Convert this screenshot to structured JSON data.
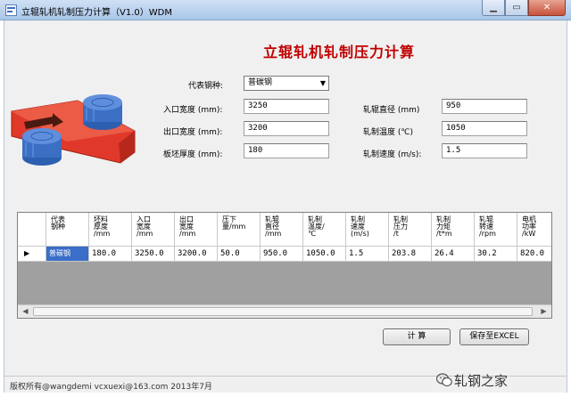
{
  "window": {
    "title": "立辊轧机轧制压力计算（V1.0）WDM"
  },
  "heading": "立辊轧机轧制压力计算",
  "form": {
    "steel_label": "代表钢种:",
    "steel_value": "普碳钢",
    "left": [
      {
        "label": "入口宽度 (mm):",
        "value": "3250"
      },
      {
        "label": "出口宽度 (mm):",
        "value": "3200"
      },
      {
        "label": "板坯厚度 (mm):",
        "value": "180"
      }
    ],
    "right": [
      {
        "label": "轧辊直径 (mm)",
        "value": "950"
      },
      {
        "label": "轧制温度 (℃)",
        "value": "1050"
      },
      {
        "label": "轧制速度 (m/s):",
        "value": "1.5"
      }
    ]
  },
  "grid": {
    "headers": [
      [
        "代表",
        "钢种"
      ],
      [
        "坯料",
        "厚度",
        "/mm"
      ],
      [
        "入口",
        "宽度",
        "/mm"
      ],
      [
        "出口",
        "宽度",
        "/mm"
      ],
      [
        "压下",
        "量/mm"
      ],
      [
        "轧辊",
        "直径",
        "/mm"
      ],
      [
        "轧制",
        "温度/",
        "℃"
      ],
      [
        "轧制",
        "速度",
        "(m/s)"
      ],
      [
        "轧制",
        "压力",
        "/t"
      ],
      [
        "轧制",
        "力矩",
        "/t*m"
      ],
      [
        "轧辊",
        "转速",
        "/rpm"
      ],
      [
        "电机",
        "功率",
        "/kW"
      ]
    ],
    "row_marker": "▶",
    "rows": [
      [
        "普碳钢",
        "180.0",
        "3250.0",
        "3200.0",
        "50.0",
        "950.0",
        "1050.0",
        "1.5",
        "203.8",
        "26.4",
        "30.2",
        "820.0"
      ]
    ]
  },
  "buttons": {
    "calc": "计 算",
    "save": "保存至EXCEL"
  },
  "status": "版权所有@wangdemi vcxuexi@163.com 2013年7月",
  "watermark": "轧钢之家",
  "colors": {
    "title_red": "#c00000",
    "selection_blue": "#3a6ec8",
    "slab_red": "#e0392b",
    "roll_blue": "#3b6fc4"
  },
  "icons": {
    "minimize": "minimize-icon",
    "maximize": "maximize-icon",
    "close": "close-icon",
    "dropdown": "chevron-down-icon"
  }
}
